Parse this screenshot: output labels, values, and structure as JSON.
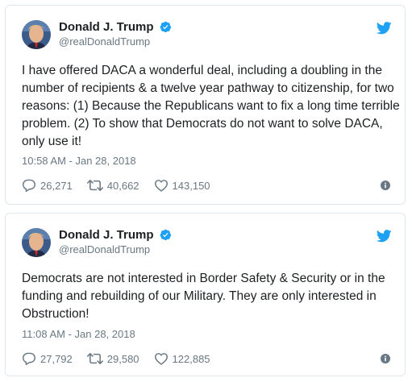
{
  "colors": {
    "border": "#e1e8ed",
    "text": "#1c2022",
    "muted": "#697882",
    "twitter_blue": "#1da1f2"
  },
  "tweets": [
    {
      "author": {
        "display_name": "Donald J. Trump",
        "handle": "@realDonaldTrump",
        "verified": true,
        "avatar_icon": "profile-photo"
      },
      "text": "I have offered DACA a wonderful deal, including a doubling in the number of recipients & a twelve year pathway to citizenship, for two reasons: (1) Because the Republicans want to fix a long time terrible problem. (2) To show that Democrats do not want to solve DACA, only use it!",
      "timestamp": "10:58 AM - Jan 28, 2018",
      "replies": "26,271",
      "retweets": "40,662",
      "likes": "143,150"
    },
    {
      "author": {
        "display_name": "Donald J. Trump",
        "handle": "@realDonaldTrump",
        "verified": true,
        "avatar_icon": "profile-photo"
      },
      "text": "Democrats are not interested in Border Safety & Security or in the funding and rebuilding of our Military. They are only interested in Obstruction!",
      "timestamp": "11:08 AM - Jan 28, 2018",
      "replies": "27,792",
      "retweets": "29,580",
      "likes": "122,885"
    }
  ]
}
